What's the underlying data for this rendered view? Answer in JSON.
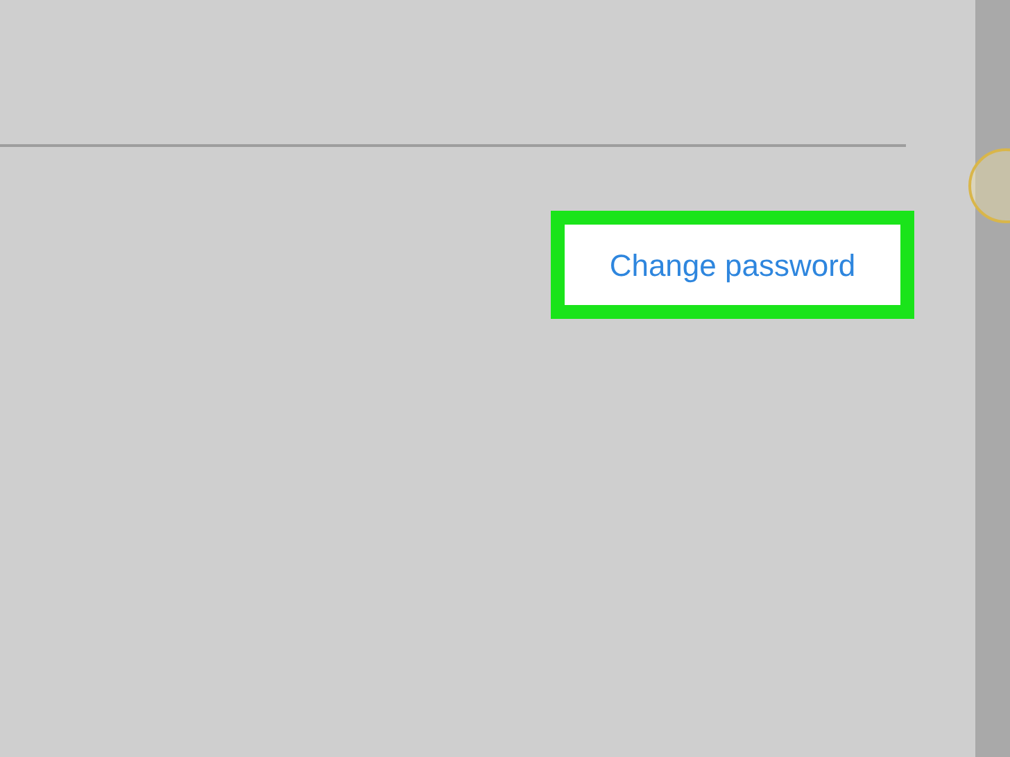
{
  "link": {
    "label": "Change password"
  }
}
